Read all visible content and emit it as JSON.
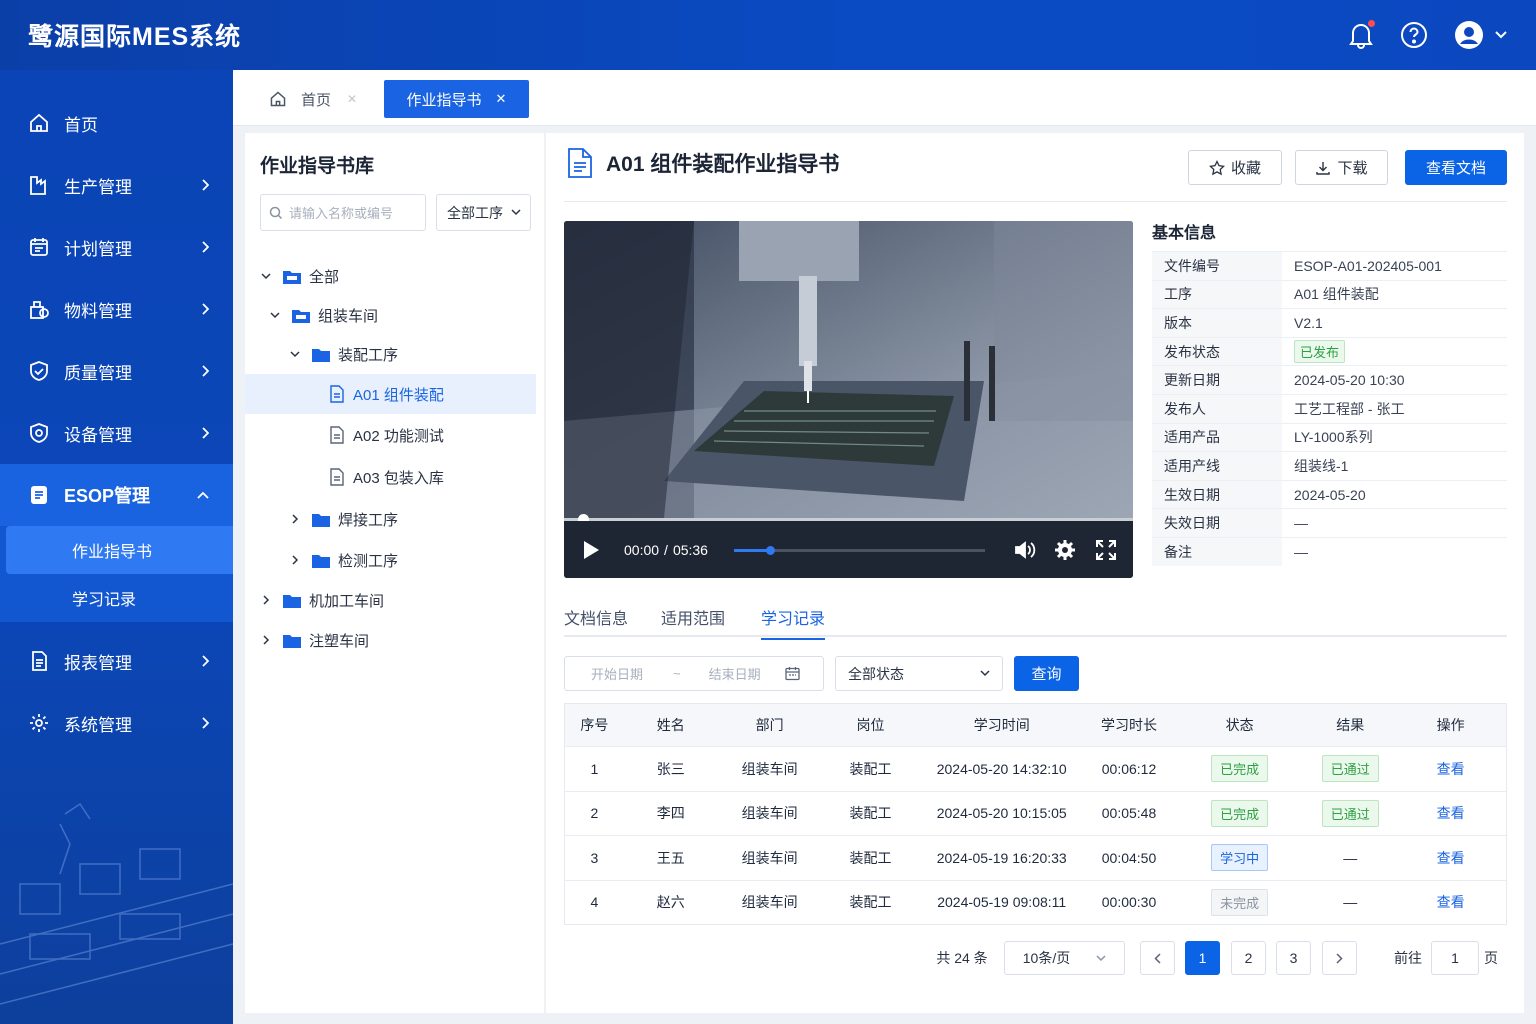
{
  "app": {
    "title": "鹭源国际MES系统"
  },
  "topbar": {
    "icons": [
      "bell-icon",
      "help-icon",
      "user-icon",
      "chevron-down-icon"
    ]
  },
  "sidebar": {
    "items": [
      {
        "label": "首页",
        "icon": "home-icon"
      },
      {
        "label": "生产管理",
        "icon": "production-icon"
      },
      {
        "label": "计划管理",
        "icon": "calendar-icon"
      },
      {
        "label": "物料管理",
        "icon": "material-icon"
      },
      {
        "label": "质量管理",
        "icon": "shield-icon"
      },
      {
        "label": "设备管理",
        "icon": "device-icon"
      },
      {
        "label": "ESOP管理",
        "icon": "esop-icon"
      },
      {
        "label": "报表管理",
        "icon": "report-icon"
      },
      {
        "label": "系统管理",
        "icon": "settings-icon"
      }
    ],
    "esop_sub": [
      {
        "label": "作业指导书"
      },
      {
        "label": "学习记录"
      }
    ]
  },
  "tabs": {
    "home": "首页",
    "active": "作业指导书"
  },
  "library": {
    "title": "作业指导书库",
    "search_placeholder": "请输入名称或编号",
    "process_filter": "全部工序",
    "tree": [
      {
        "label": "全部"
      },
      {
        "label": "组装车间"
      },
      {
        "label": "装配工序"
      },
      {
        "label": "A01 组件装配"
      },
      {
        "label": "A02 功能测试"
      },
      {
        "label": "A03 包装入库"
      },
      {
        "label": "焊接工序"
      },
      {
        "label": "检测工序"
      },
      {
        "label": "机加工车间"
      },
      {
        "label": "注塑车间"
      }
    ]
  },
  "doc": {
    "title": "A01 组件装配作业指导书",
    "btn_fav": "收藏",
    "btn_download": "下载",
    "btn_view": "查看文档"
  },
  "video": {
    "current": "00:00",
    "sep": "/",
    "duration": "05:36",
    "progress": 0.02,
    "volume": 0.15
  },
  "info": {
    "title": "基本信息",
    "rows": [
      {
        "k": "文件编号",
        "v": "ESOP-A01-202405-001"
      },
      {
        "k": "工序",
        "v": "A01 组件装配"
      },
      {
        "k": "版本",
        "v": "V2.1"
      },
      {
        "k": "发布状态",
        "v": "已发布"
      },
      {
        "k": "更新日期",
        "v": "2024-05-20 10:30"
      },
      {
        "k": "发布人",
        "v": "工艺工程部 - 张工"
      },
      {
        "k": "适用产品",
        "v": "LY-1000系列"
      },
      {
        "k": "适用产线",
        "v": "组装线-1"
      },
      {
        "k": "生效日期",
        "v": "2024-05-20"
      },
      {
        "k": "失效日期",
        "v": "—"
      },
      {
        "k": "备注",
        "v": "—"
      }
    ]
  },
  "subtabs": [
    "文档信息",
    "适用范围",
    "学习记录"
  ],
  "filters": {
    "start": "开始日期",
    "tilde": "~",
    "end": "结束日期",
    "status": "全部状态",
    "query": "查询"
  },
  "table": {
    "headers": [
      "序号",
      "姓名",
      "部门",
      "岗位",
      "学习时间",
      "学习时长",
      "状态",
      "结果",
      "操作"
    ],
    "rows": [
      {
        "no": "1",
        "name": "张三",
        "dept": "组装车间",
        "post": "装配工",
        "time": "2024-05-20 14:32:10",
        "dur": "00:06:12",
        "status": "已完成",
        "result": "已通过",
        "op": "查看"
      },
      {
        "no": "2",
        "name": "李四",
        "dept": "组装车间",
        "post": "装配工",
        "time": "2024-05-20 10:15:05",
        "dur": "00:05:48",
        "status": "已完成",
        "result": "已通过",
        "op": "查看"
      },
      {
        "no": "3",
        "name": "王五",
        "dept": "组装车间",
        "post": "装配工",
        "time": "2024-05-19 16:20:33",
        "dur": "00:04:50",
        "status": "学习中",
        "result": "—",
        "op": "查看"
      },
      {
        "no": "4",
        "name": "赵六",
        "dept": "组装车间",
        "post": "装配工",
        "time": "2024-05-19 09:08:11",
        "dur": "00:00:30",
        "status": "未完成",
        "result": "—",
        "op": "查看"
      }
    ]
  },
  "pagination": {
    "total": "共 24 条",
    "size": "10条/页",
    "pages": [
      "1",
      "2",
      "3"
    ],
    "goto": "前往",
    "goto_value": "1",
    "page_unit": "页"
  },
  "colors": {
    "primary": "#0b63e5",
    "sidebar": "#0a44b6",
    "success": "#2ea043"
  }
}
